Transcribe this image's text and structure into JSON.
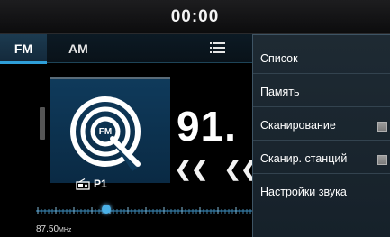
{
  "status_bar": {
    "clock": "00:00"
  },
  "tabs": [
    {
      "label": "FM",
      "active": true
    },
    {
      "label": "AM",
      "active": false
    }
  ],
  "menu_button": {
    "icon": "list-menu-icon"
  },
  "station": {
    "artwork_icon": "fm-radio-icon",
    "artwork_text": "FM",
    "preset_label": "P1",
    "preset_icon": "radio-preset-icon",
    "frequency_display": "91.",
    "frequency_value": 87.5,
    "frequency_number": "87.50",
    "frequency_unit": "MHz"
  },
  "controls": {
    "seek_back_label": "|<<",
    "seek_back_icon": "skip-back-icon",
    "rewind_label": "<<",
    "rewind_icon": "rewind-icon"
  },
  "popup_menu": {
    "items": [
      {
        "label": "Список",
        "checkbox": false
      },
      {
        "label": "Память",
        "checkbox": false
      },
      {
        "label": "Сканирование",
        "checkbox": true,
        "checked": false
      },
      {
        "label": "Сканир. станций",
        "checkbox": true,
        "checked": false
      },
      {
        "label": "Настройки звука",
        "checkbox": false
      }
    ]
  },
  "colors": {
    "accent": "#2f9fd9",
    "background": "#000000",
    "popup_bg": "#1e2a33",
    "artwork_bg": "#0f3a5b"
  }
}
